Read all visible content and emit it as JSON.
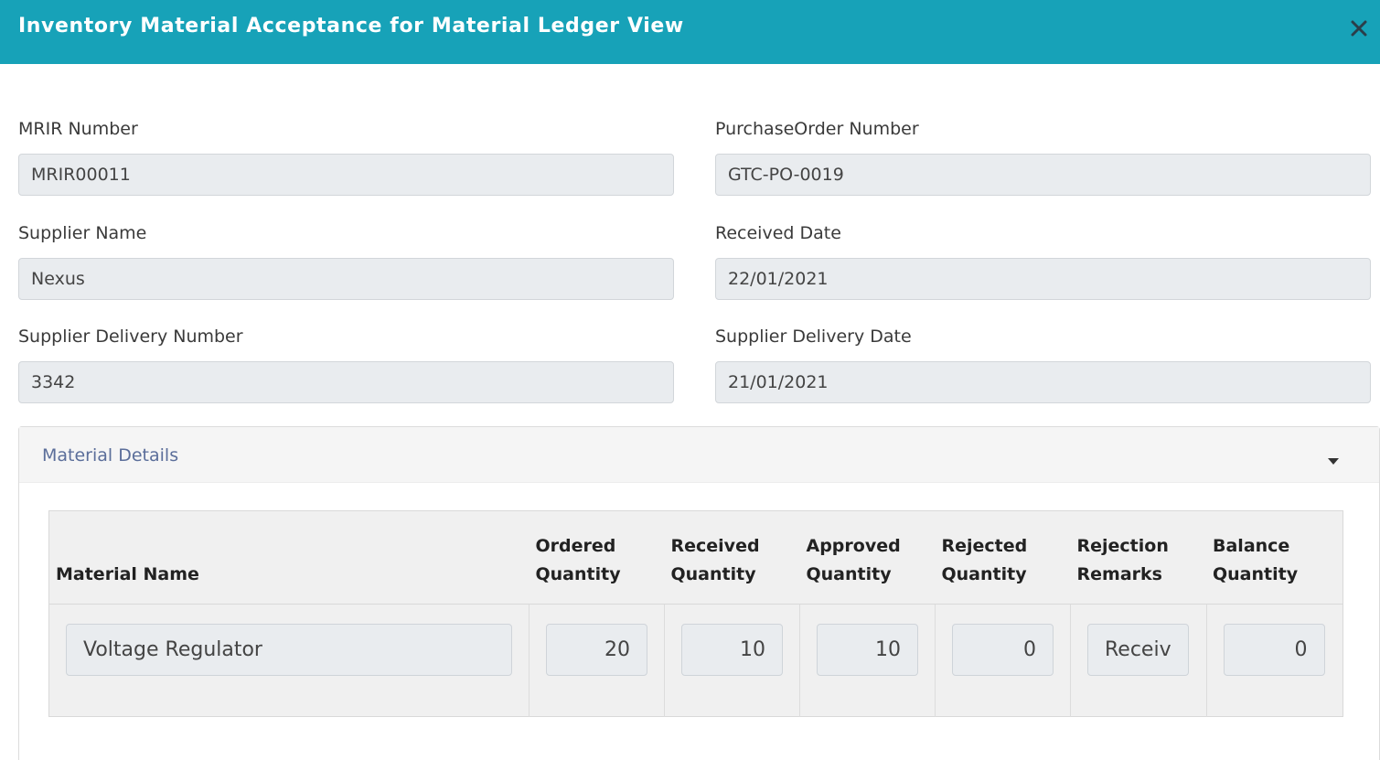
{
  "modal": {
    "title": "Inventory Material Acceptance for Material Ledger View",
    "close_icon": "close-icon",
    "colors": {
      "header": "#17a2b8",
      "input_bg": "#e9ecef",
      "panel_title": "#5b6e9a"
    }
  },
  "form": {
    "mrir_number": {
      "label": "MRIR Number",
      "value": "MRIR00011"
    },
    "po_number": {
      "label": "PurchaseOrder Number",
      "value": "GTC-PO-0019"
    },
    "supplier_name": {
      "label": "Supplier Name",
      "value": "Nexus"
    },
    "received_date": {
      "label": "Received Date",
      "value": "22/01/2021"
    },
    "supplier_delivery_number": {
      "label": "Supplier Delivery Number",
      "value": "3342"
    },
    "supplier_delivery_date": {
      "label": "Supplier Delivery Date",
      "value": "21/01/2021"
    }
  },
  "material_details": {
    "title": "Material Details",
    "toggle_icon": "caret-down-icon",
    "columns": {
      "material_name": "Material Name",
      "ordered_1": "Ordered",
      "ordered_2": "Quantity",
      "received_1": "Received",
      "received_2": "Quantity",
      "approved_1": "Approved",
      "approved_2": "Quantity",
      "rejected_1": "Rejected",
      "rejected_2": "Quantity",
      "remarks_1": "Rejection",
      "remarks_2": "Remarks",
      "balance_1": "Balance",
      "balance_2": "Quantity"
    },
    "rows": [
      {
        "material_name": "Voltage Regulator",
        "ordered": "20",
        "received": "10",
        "approved": "10",
        "rejected": "0",
        "remarks": "Received",
        "balance": "0"
      }
    ]
  }
}
